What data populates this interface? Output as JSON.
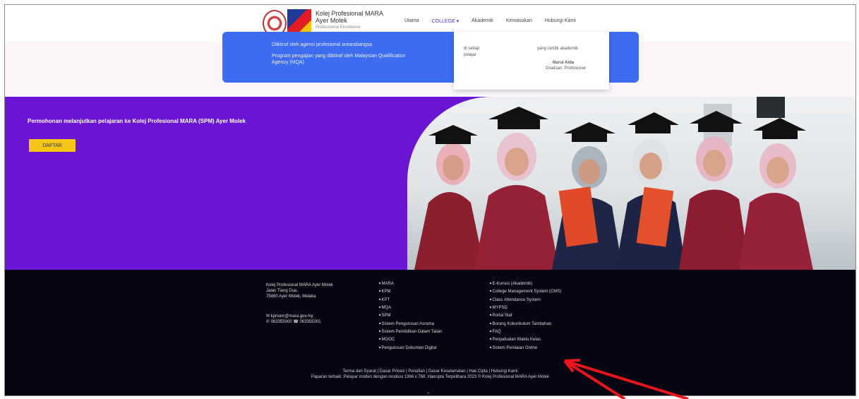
{
  "header": {
    "brand_name": "Kolej Profesional MARA",
    "brand_sub": "Ayer Molek",
    "brand_tagline": "Professional Excellence",
    "nav": [
      "Utama",
      "COLLEGE ▾",
      "Akademik",
      "Kemasukan",
      "Hubungi Kami"
    ]
  },
  "bluecard": {
    "line1": "Diiktiraf oleh agensi profesional antarabangsa",
    "line2": "Program pengajian yang diiktiraf oleh Malaysian Qualification",
    "line3": "Agency (MQA)"
  },
  "dropdown": {
    "left1": "di setiap",
    "left2": "pelajar",
    "right1": "yang cerdik akademik",
    "right2": "Nurul Aida",
    "right3": "Graduan, Profesional"
  },
  "hero": {
    "title": "Permohonan melanjutkan pelajaran ke Kolej Profesional MARA (SPM) Ayer Molek",
    "button": "DAFTAR"
  },
  "footer": {
    "address": [
      "Kolej Profesional MARA Ayer Molek",
      "Jalan Tiang Dua,",
      "75460 Ayer Molek, Melaka"
    ],
    "contact_email": "kpmam@mara.gov.my",
    "contact_phone": "063355000",
    "contact_fax": "063355001",
    "col2": [
      "MARA",
      "KPM",
      "KPT",
      "MQA",
      "SPM",
      "Sistem Pengurusan Asrama",
      "Sistem Pendidikan Dalam Talian",
      "MOOC",
      "Pengurusan Dokumen Digital"
    ],
    "col3": [
      "E-Kursus (Akademik)",
      "College Management System (CMS)",
      "Class Attendance System",
      "MYPSD",
      "Portal Staf",
      "Borang Kokurikulum Tambahan",
      "FAQ",
      "Penjadualan Waktu Kelas",
      "Sistem Penilaian Online"
    ],
    "bottom1": "Terma dan Syarat | Dasar Privasi | Penafian | Dasar Keselamatan | Hak Cipta | Hubungi Kami",
    "bottom2": "Paparan terbaik: Pelayar moden dengan resolusi 1366 x 768. Hakcipta Terpelihara 2023 © Kolej Profesional MARA Ayer Molek",
    "top_icon": "^"
  },
  "colors": {
    "hero_bg": "#6a14d4",
    "footer_bg": "#050611",
    "blue_card": "#3d6cf0",
    "button": "#f5c518",
    "arrow": "#e8141a"
  }
}
